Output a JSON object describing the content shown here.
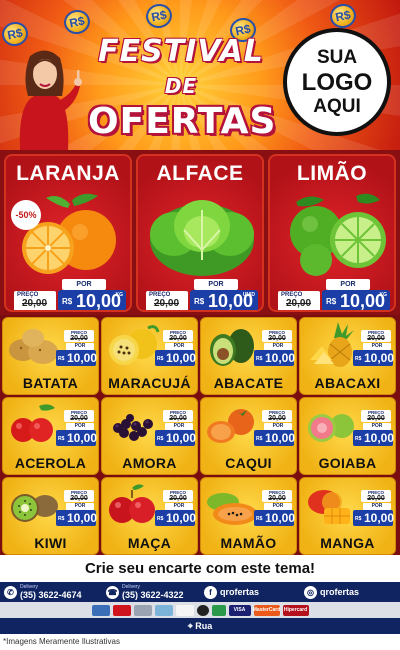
{
  "header": {
    "title_top": "FESTIVAL",
    "title_de": "DE",
    "title_bottom": "OFERTAS",
    "coin_symbol": "R$",
    "logo_line1": "SUA",
    "logo_line2": "LOGO",
    "logo_line3": "AQUI"
  },
  "featured": [
    {
      "name": "LARANJA",
      "discount": "-50%",
      "por": "POR",
      "old_label": "PREÇO",
      "old_price": "20,00",
      "currency": "R$",
      "price": "10,00",
      "unit": "KG",
      "icon": "orange-icon"
    },
    {
      "name": "ALFACE",
      "por": "POR",
      "old_label": "PREÇO",
      "old_price": "20,00",
      "currency": "R$",
      "price": "10,00",
      "unit": "UNID",
      "icon": "lettuce-icon"
    },
    {
      "name": "LIMÃO",
      "por": "POR",
      "old_label": "PREÇO",
      "old_price": "20,00",
      "currency": "R$",
      "price": "10,00",
      "unit": "KG",
      "icon": "lime-icon"
    }
  ],
  "grid": [
    {
      "name": "BATATA",
      "icon": "potato-icon",
      "old_label": "PREÇO",
      "old_price": "20,00",
      "por": "POR",
      "currency": "R$",
      "price": "10,00"
    },
    {
      "name": "MARACUJÁ",
      "icon": "passion-fruit-icon",
      "old_label": "PREÇO",
      "old_price": "20,00",
      "por": "POR",
      "currency": "R$",
      "price": "10,00"
    },
    {
      "name": "ABACATE",
      "icon": "avocado-icon",
      "old_label": "PREÇO",
      "old_price": "20,00",
      "por": "POR",
      "currency": "R$",
      "price": "10,00"
    },
    {
      "name": "ABACAXI",
      "icon": "pineapple-icon",
      "old_label": "PREÇO",
      "old_price": "20,00",
      "por": "POR",
      "currency": "R$",
      "price": "10,00"
    },
    {
      "name": "ACEROLA",
      "icon": "acerola-icon",
      "old_label": "PREÇO",
      "old_price": "20,00",
      "por": "POR",
      "currency": "R$",
      "price": "10,00"
    },
    {
      "name": "AMORA",
      "icon": "blackberry-icon",
      "old_label": "PREÇO",
      "old_price": "20,00",
      "por": "POR",
      "currency": "R$",
      "price": "10,00"
    },
    {
      "name": "CAQUI",
      "icon": "persimmon-icon",
      "old_label": "PREÇO",
      "old_price": "20,00",
      "por": "POR",
      "currency": "R$",
      "price": "10,00"
    },
    {
      "name": "GOIABA",
      "icon": "guava-icon",
      "old_label": "PREÇO",
      "old_price": "20,00",
      "por": "POR",
      "currency": "R$",
      "price": "10,00"
    },
    {
      "name": "KIWI",
      "icon": "kiwi-icon",
      "old_label": "PREÇO",
      "old_price": "20,00",
      "por": "POR",
      "currency": "R$",
      "price": "10,00"
    },
    {
      "name": "MAÇA",
      "icon": "apple-icon",
      "old_label": "PREÇO",
      "old_price": "20,00",
      "por": "POR",
      "currency": "R$",
      "price": "10,00"
    },
    {
      "name": "MAMÃO",
      "icon": "papaya-icon",
      "old_label": "PREÇO",
      "old_price": "20,00",
      "por": "POR",
      "currency": "R$",
      "price": "10,00"
    },
    {
      "name": "MANGA",
      "icon": "mango-icon",
      "old_label": "PREÇO",
      "old_price": "20,00",
      "por": "POR",
      "currency": "R$",
      "price": "10,00"
    }
  ],
  "banner": "Crie seu encarte com este tema!",
  "contacts": [
    {
      "label": "Delivery",
      "value": "(35) 3622-4674",
      "icon": "whatsapp-icon"
    },
    {
      "label": "Delivery",
      "value": "(35) 3622-4322",
      "icon": "phone-icon"
    },
    {
      "label": "",
      "value": "qrofertas",
      "icon": "facebook-icon"
    },
    {
      "label": "",
      "value": "qrofertas",
      "icon": "instagram-icon"
    }
  ],
  "payments": [
    "VISA",
    "MasterCard",
    "Hipercard"
  ],
  "address": "Rua",
  "disclaimer": "*Imagens Meramente Ilustrativas",
  "colors": {
    "header_red": "#c2180f",
    "featured_red": "#e2232a",
    "grid_yellow": "#ffd84a",
    "price_blue": "#1b3fa6",
    "footer_navy": "#0f2460"
  }
}
